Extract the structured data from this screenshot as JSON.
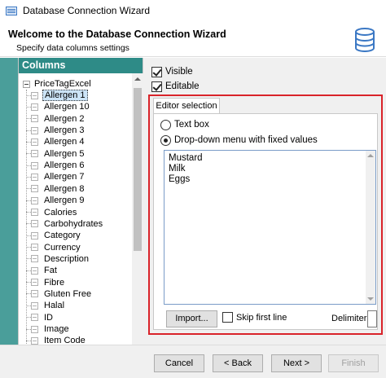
{
  "window": {
    "title": "Database Connection Wizard"
  },
  "header": {
    "title": "Welcome to the Database Connection Wizard",
    "subtitle": "Specify data columns settings"
  },
  "columns_panel": {
    "title": "Columns",
    "root": "PriceTagExcel",
    "items": [
      "Allergen 1",
      "Allergen 10",
      "Allergen 2",
      "Allergen 3",
      "Allergen 4",
      "Allergen 5",
      "Allergen 6",
      "Allergen 7",
      "Allergen 8",
      "Allergen 9",
      "Calories",
      "Carbohydrates",
      "Category",
      "Currency",
      "Description",
      "Fat",
      "Fibre",
      "Gluten Free",
      "Halal",
      "ID",
      "Image",
      "Item Code"
    ],
    "selected": "Allergen 1"
  },
  "options": {
    "visible": {
      "label": "Visible",
      "checked": true
    },
    "editable": {
      "label": "Editable",
      "checked": true
    }
  },
  "editor_selection": {
    "tab_label": "Editor selection",
    "textbox_label": "Text box",
    "dropdown_label": "Drop-down menu with fixed values",
    "selected_mode": "dropdown",
    "values": [
      "Mustard",
      "Milk",
      "Eggs"
    ],
    "import_label": "Import...",
    "skip_first_line_label": "Skip first line",
    "skip_first_line_checked": false,
    "delimiter_label": "Delimiter:",
    "delimiter_value": ""
  },
  "footer": {
    "cancel": "Cancel",
    "back": "< Back",
    "next": "Next >",
    "finish": "Finish"
  },
  "colors": {
    "columns_header": "#2e8b87",
    "left_strip": "#4a9e9a",
    "highlight_frame": "#d9232a",
    "selection": "#cce4f7"
  }
}
